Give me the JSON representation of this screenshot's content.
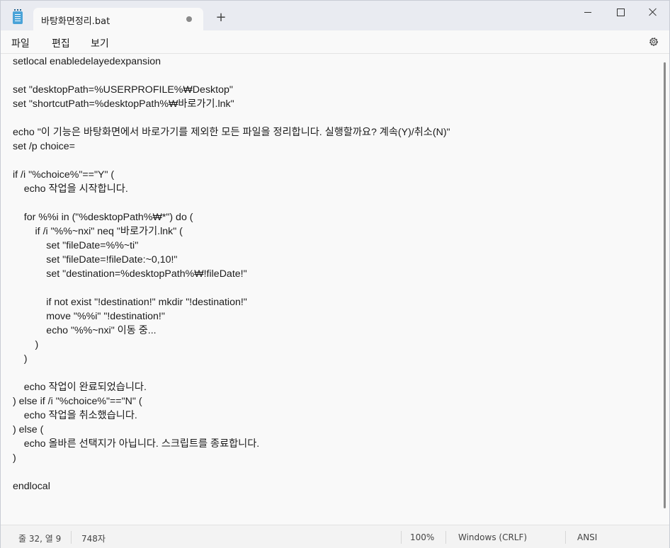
{
  "tab": {
    "title": "바탕화면정리.bat"
  },
  "menu": {
    "file": "파일",
    "edit": "편집",
    "view": "보기"
  },
  "editor": {
    "lines": [
      "setlocal enabledelayedexpansion",
      "",
      "set \"desktopPath=%USERPROFILE%₩Desktop\"",
      "set \"shortcutPath=%desktopPath%₩바로가기.lnk\"",
      "",
      "echo \"이 기능은 바탕화면에서 바로가기를 제외한 모든 파일을 정리합니다. 실행할까요? 계속(Y)/취소(N)\"",
      "set /p choice=",
      "",
      "if /i \"%choice%\"==\"Y\" (",
      "    echo 작업을 시작합니다.",
      "",
      "    for %%i in (\"%desktopPath%₩*\") do (",
      "        if /i \"%%~nxi\" neq \"바로가기.lnk\" (",
      "            set \"fileDate=%%~ti\"",
      "            set \"fileDate=!fileDate:~0,10!\"",
      "            set \"destination=%desktopPath%₩!fileDate!\"",
      "",
      "            if not exist \"!destination!\" mkdir \"!destination!\"",
      "            move \"%%i\" \"!destination!\"",
      "            echo \"%%~nxi\" 이동 중...",
      "        )",
      "    )",
      "",
      "    echo 작업이 완료되었습니다.",
      ") else if /i \"%choice%\"==\"N\" (",
      "    echo 작업을 취소했습니다.",
      ") else (",
      "    echo 올바른 선택지가 아닙니다. 스크립트를 종료합니다.",
      ")",
      "",
      "endlocal"
    ]
  },
  "status": {
    "position": "줄 32, 열 9",
    "char_count": "748자",
    "zoom": "100%",
    "line_ending": "Windows (CRLF)",
    "encoding": "ANSI"
  }
}
